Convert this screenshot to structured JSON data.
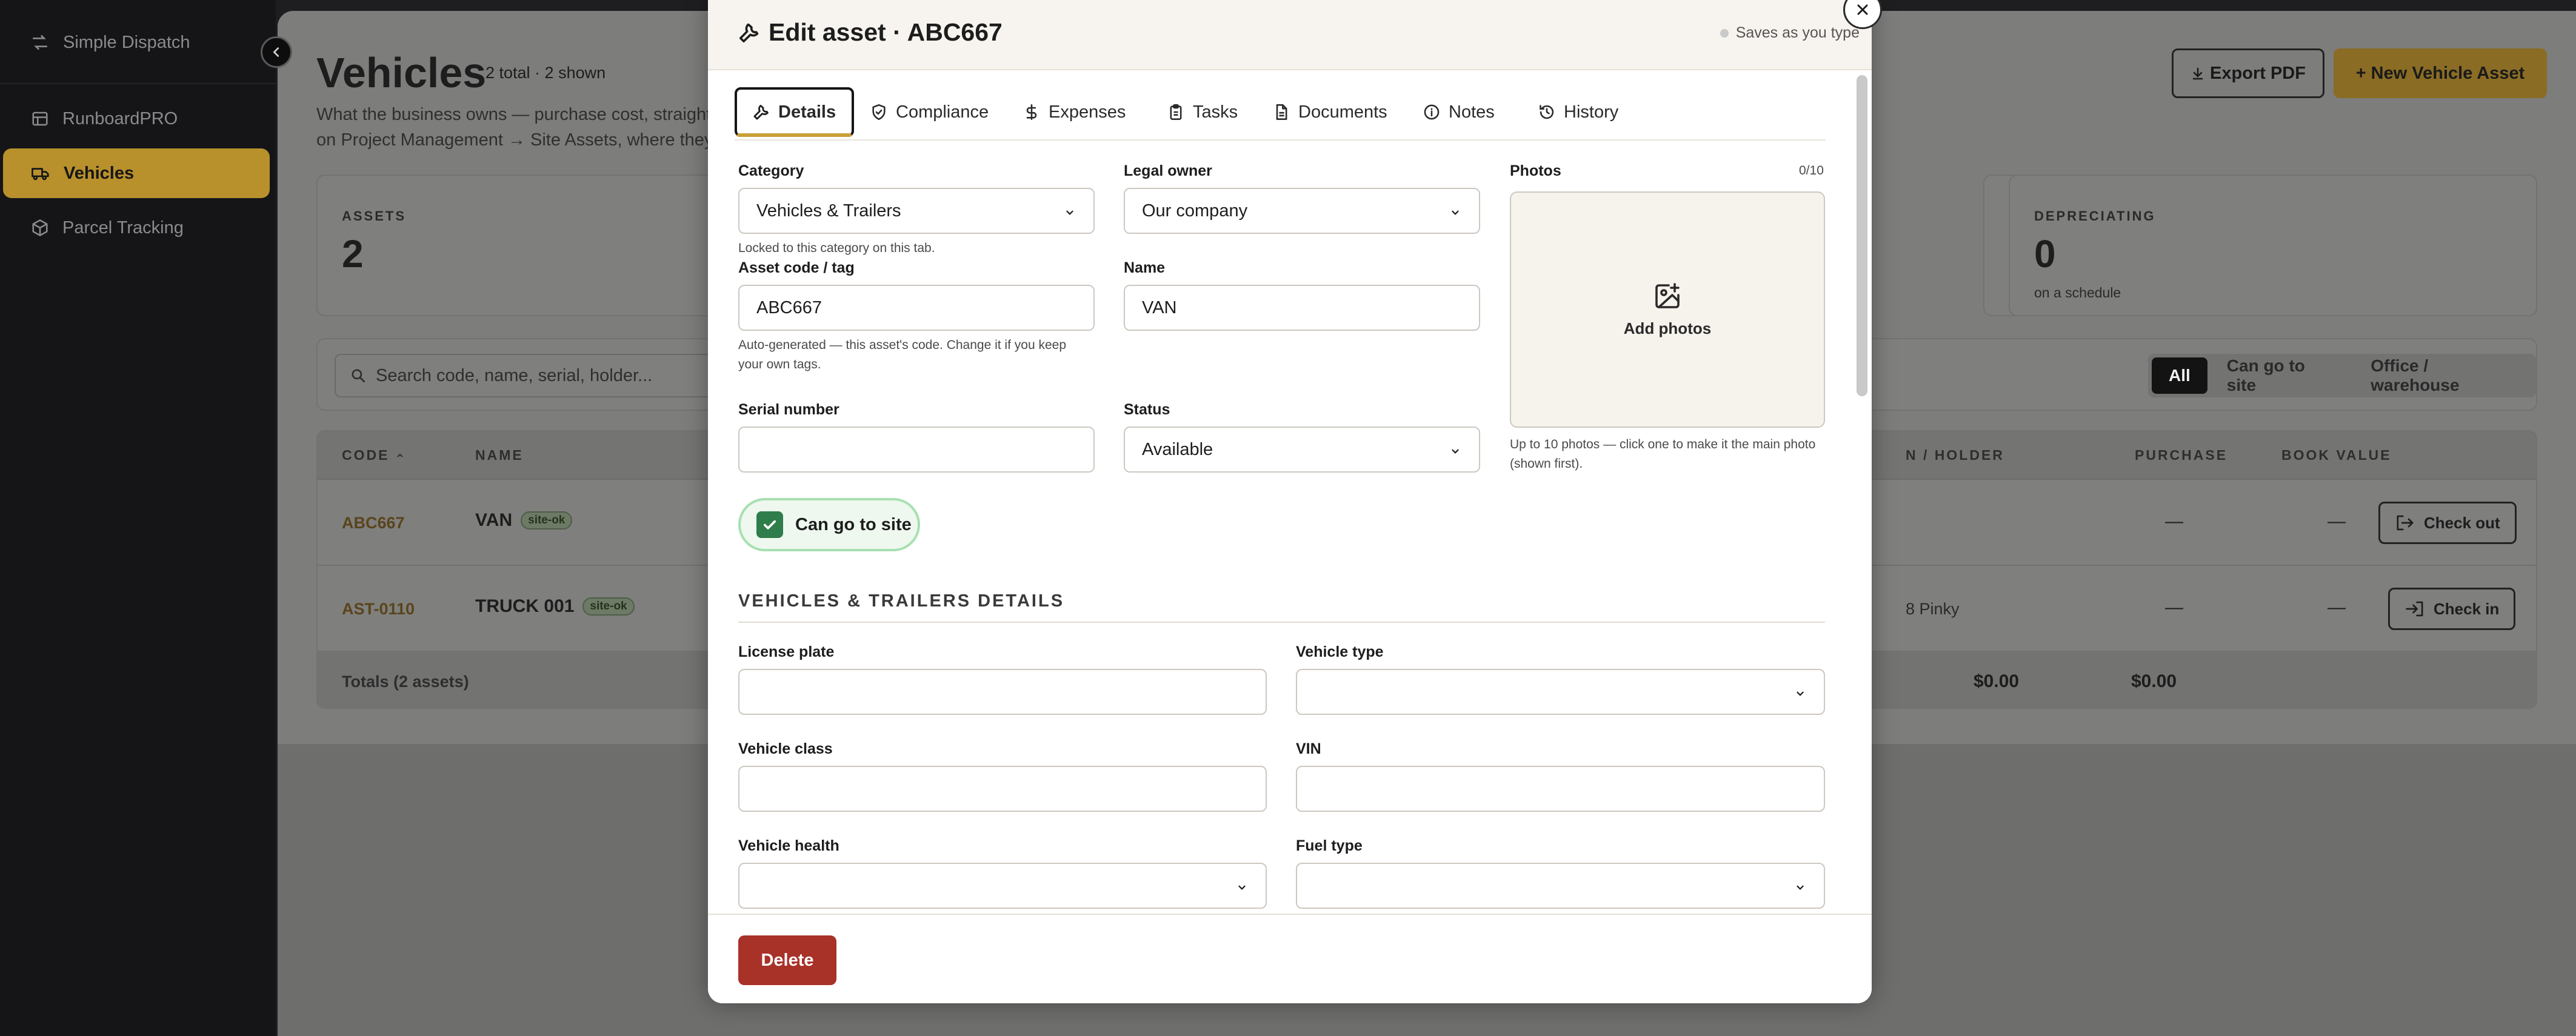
{
  "sidebar": {
    "brand": "Simple Dispatch",
    "items": [
      {
        "label": "RunboardPRO"
      },
      {
        "label": "Vehicles"
      },
      {
        "label": "Parcel Tracking"
      }
    ]
  },
  "page": {
    "title": "Vehicles",
    "subtitle": "2 total · 2 shown",
    "description_line1": "What the business owns — purchase cost, straight-li",
    "description_line2": "on Project Management → Site Assets, where they're",
    "export_label": "Export PDF",
    "new_label": "+ New Vehicle Asset",
    "stats": [
      {
        "label": "ASSETS",
        "value": "2",
        "note": ""
      },
      {
        "label": "DEPRECIATING",
        "value": "0",
        "note": "on a schedule"
      }
    ],
    "search_placeholder": "Search code, name, serial, holder...",
    "filters": [
      "All",
      "Can go to site",
      "Office / warehouse"
    ],
    "table": {
      "columns": [
        "CODE",
        "NAME",
        "N / HOLDER",
        "PURCHASE",
        "BOOK VALUE"
      ],
      "rows": [
        {
          "code": "ABC667",
          "name": "VAN",
          "badge": "site-ok",
          "holder": "",
          "purchase": "—",
          "book": "—",
          "action": "Check out"
        },
        {
          "code": "AST-0110",
          "name": "TRUCK 001",
          "badge": "site-ok",
          "holder": "8 Pinky",
          "purchase": "—",
          "book": "—",
          "action": "Check in"
        }
      ],
      "totals_label": "Totals (2 assets)",
      "totals_purchase": "$0.00",
      "totals_book": "$0.00"
    }
  },
  "modal": {
    "title": "Edit asset · ABC667",
    "saves_label": "Saves as you type",
    "tabs": [
      "Details",
      "Compliance",
      "Expenses",
      "Tasks",
      "Documents",
      "Notes",
      "History"
    ],
    "active_tab": "Details",
    "category": {
      "label": "Category",
      "value": "Vehicles & Trailers",
      "hint": "Locked to this category on this tab."
    },
    "legal_owner": {
      "label": "Legal owner",
      "value": "Our company"
    },
    "photos": {
      "label": "Photos",
      "count": "0/10",
      "add_label": "Add photos",
      "hint_line1": "Up to 10 photos — click one to make it the main photo",
      "hint_line2": "(shown first)."
    },
    "asset_code": {
      "label": "Asset code / tag",
      "value": "ABC667",
      "hint_line1": "Auto-generated — this asset's code. Change it if you keep",
      "hint_line2": "your own tags."
    },
    "name": {
      "label": "Name",
      "value": "VAN"
    },
    "serial": {
      "label": "Serial number",
      "value": ""
    },
    "status": {
      "label": "Status",
      "value": "Available"
    },
    "can_go_to_site": {
      "label": "Can go to site",
      "checked": true
    },
    "section_title": "VEHICLES & TRAILERS DETAILS",
    "license_plate": {
      "label": "License plate",
      "value": ""
    },
    "vehicle_type": {
      "label": "Vehicle type",
      "value": ""
    },
    "vehicle_class": {
      "label": "Vehicle class",
      "value": ""
    },
    "vin": {
      "label": "VIN",
      "value": ""
    },
    "vehicle_health": {
      "label": "Vehicle health",
      "value": ""
    },
    "fuel_type": {
      "label": "Fuel type",
      "value": ""
    },
    "delete_label": "Delete"
  },
  "colors": {
    "accent": "#caa038",
    "danger": "#a83128",
    "success": "#2f7d4a",
    "sidebar_active": "#b8902c"
  }
}
